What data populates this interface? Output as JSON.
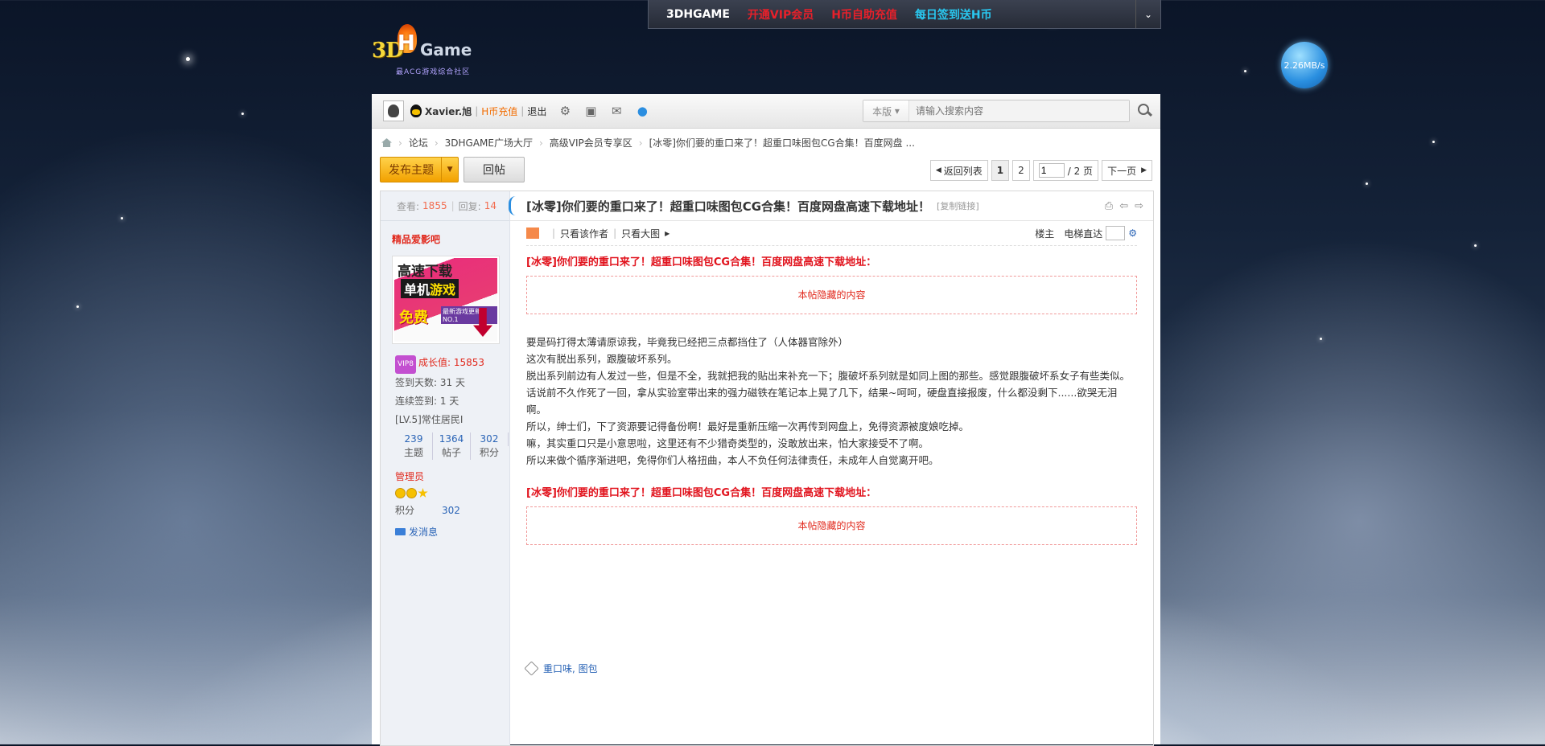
{
  "topbar": {
    "links": [
      {
        "label": "3DHGAME",
        "color": "#ffffff"
      },
      {
        "label": "开通VIP会员",
        "color": "#e8202a"
      },
      {
        "label": "H币自助充值",
        "color": "#e8202a"
      },
      {
        "label": "每日签到送H币",
        "color": "#29c8f0"
      }
    ]
  },
  "logo": {
    "part1": "3D",
    "part2": "H",
    "part3": "Game",
    "sub": "最ACG游戏综合社区"
  },
  "speed": "2.26MB/s",
  "toolbar": {
    "username": "Xavier.旭",
    "recharge": "H币充值",
    "logout": "退出",
    "search_scope": "本版",
    "search_placeholder": "请输入搜索内容"
  },
  "breadcrumb": [
    "论坛",
    "3DHGAME广场大厅",
    "高级VIP会员专享区",
    "[冰零]你们要的重口来了！超重口味图包CG合集！百度网盘 ..."
  ],
  "actions": {
    "post": "发布主题",
    "reply": "回帖"
  },
  "pager": {
    "back": "返回列表",
    "pages": [
      "1",
      "2"
    ],
    "current": "1",
    "total": "/ 2 页",
    "next": "下一页"
  },
  "post": {
    "views_label": "查看:",
    "views": "1855",
    "replies_label": "回复:",
    "replies": "14",
    "title": "[冰零]你们要的重口来了！超重口味图包CG合集！百度网盘高速下载地址！",
    "copy_link": "[复制链接]",
    "author_filter": "只看该作者",
    "big_image": "只看大图",
    "floor": "楼主",
    "elevator": "电梯直达",
    "content_title": "[冰零]你们要的重口来了！超重口味图包CG合集！百度网盘高速下载地址：",
    "hidden_text": "本帖隐藏的内容",
    "paragraphs": [
      "要是码打得太薄请原谅我，毕竟我已经把三点都挡住了（人体器官除外）",
      "这次有脱出系列，跟腹破坏系列。",
      "脱出系列前边有人发过一些，但是不全，我就把我的贴出来补充一下；腹破坏系列就是如同上图的那些。感觉跟腹破坏系女子有些类似。",
      "话说前不久作死了一回，拿从实验室带出来的强力磁铁在笔记本上晃了几下，结果~呵呵，硬盘直接报废，什么都没剩下......欲哭无泪啊。",
      "所以，绅士们，下了资源要记得备份啊！最好是重新压缩一次再传到网盘上，免得资源被度娘吃掉。",
      "嘛，其实重口只是小意思啦，这里还有不少猎奇类型的，没敢放出来，怕大家接受不了啊。",
      "所以来做个循序渐进吧，免得你们人格扭曲，本人不负任何法律责任，未成年人自觉离开吧。"
    ],
    "tags": "重口味, 图包"
  },
  "author": {
    "name": "精品爱影吧",
    "avatar_text": {
      "t1": "高速下载",
      "t2a": "单机",
      "t2b": "游戏",
      "t3": "免费",
      "t4": "最新游戏更新NO.1"
    },
    "vip": "VIP8",
    "growth_label": "成长值:",
    "growth": "15853",
    "sign_days": "签到天数: 31 天",
    "streak": "连续签到: 1 天",
    "level": "[LV.5]常住居民I",
    "stats": [
      {
        "num": "239",
        "label": "主题"
      },
      {
        "num": "1364",
        "label": "帖子"
      },
      {
        "num": "302",
        "label": "积分"
      }
    ],
    "role": "管理员",
    "points_label": "积分",
    "points": "302",
    "message": "发消息"
  }
}
